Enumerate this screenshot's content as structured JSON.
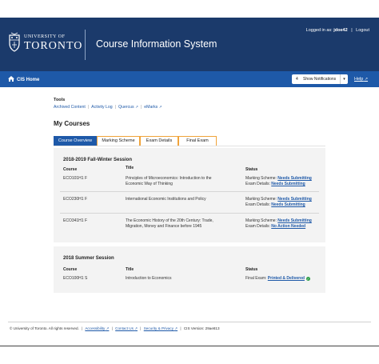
{
  "header": {
    "university_of": "UNIVERSITY OF",
    "toronto": "TORONTO",
    "app_title": "Course Information System",
    "logged_in_prefix": "Logged in as:",
    "username": "jdoe42",
    "separator": "|",
    "logout": "Logout"
  },
  "navbar": {
    "home": "CIS Home",
    "notifications_count": "4",
    "notifications_label": "Show Notifications",
    "help": "Help"
  },
  "tools": {
    "heading": "Tools",
    "links": [
      "Archived Content",
      "Activity Log",
      "Quercus",
      "eMarks"
    ],
    "separator": "|"
  },
  "my_courses": {
    "heading": "My Courses",
    "tabs": [
      "Course Overview",
      "Marking Scheme",
      "Exam Details",
      "Final Exam"
    ]
  },
  "sessions": [
    {
      "title": "2018-2019 Fall-Winter Session",
      "columns": [
        "Course",
        "Title",
        "Status"
      ],
      "rows": [
        {
          "course": "ECO101H1 F",
          "title_line1": "Principles of Microeconomics: Introduction to the",
          "title_line2": "Economic Way of Thinking",
          "s1_label": "Marking Scheme:",
          "s1_value": "Needs Submitting",
          "s2_label": "Exam Details:",
          "s2_value": "Needs Submitting"
        },
        {
          "course": "ECO230H1 F",
          "title_line1": "International Economic Institutions and Policy",
          "title_line2": "",
          "s1_label": "Marking Scheme:",
          "s1_value": "Needs Submitting",
          "s2_label": "Exam Details:",
          "s2_value": "Needs Submitting"
        },
        {
          "course": "ECO341H1 F",
          "title_line1": "The Economic History of the 20th Century: Trade,",
          "title_line2": "Migration, Money and Finance before 1945",
          "s1_label": "Marking Scheme:",
          "s1_value": "Needs Submitting",
          "s2_label": "Exam Details:",
          "s2_value": "No Action Needed"
        }
      ]
    },
    {
      "title": "2018 Summer Session",
      "columns": [
        "Course",
        "Title",
        "Status"
      ],
      "rows": [
        {
          "course": "ECO100H1 S",
          "title_line1": "Introduction to Economics",
          "s1_label": "Final Exam:",
          "s1_value": "Printed & Delivered"
        }
      ]
    }
  ],
  "footer": {
    "copyright": "© University of Toronto. All rights reserved.",
    "accessibility": "Accessibility",
    "contact": "Contact Us",
    "security": "Security & Privacy",
    "version": "CIS Version: 29ae813",
    "separator": "|"
  },
  "colors": {
    "header_bg": "#1b3a6b",
    "nav_bg": "#1e59a8",
    "tab_border": "#f0a33a",
    "success": "#2e9e48"
  }
}
